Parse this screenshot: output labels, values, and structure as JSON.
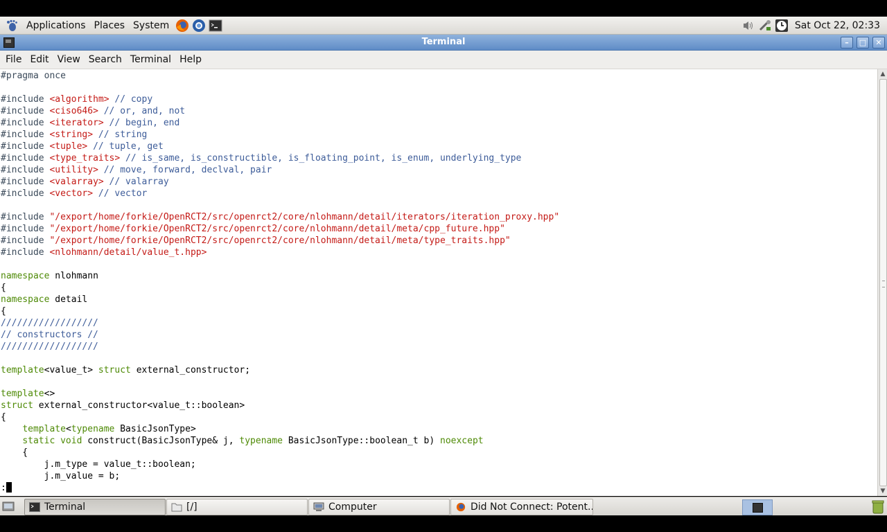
{
  "panel": {
    "menus": [
      "Applications",
      "Places",
      "System"
    ],
    "clock": "Sat Oct 22, 02:33"
  },
  "window": {
    "title": "Terminal",
    "menu": [
      "File",
      "Edit",
      "View",
      "Search",
      "Terminal",
      "Help"
    ]
  },
  "terminal": {
    "lines": [
      [
        [
          "pp",
          "#pragma once"
        ]
      ],
      [],
      [
        [
          "inc",
          "#include "
        ],
        [
          "hdr",
          "<algorithm>"
        ],
        [
          "cmt",
          " // copy"
        ]
      ],
      [
        [
          "inc",
          "#include "
        ],
        [
          "hdr",
          "<ciso646>"
        ],
        [
          "cmt",
          " // or, and, not"
        ]
      ],
      [
        [
          "inc",
          "#include "
        ],
        [
          "hdr",
          "<iterator>"
        ],
        [
          "cmt",
          " // begin, end"
        ]
      ],
      [
        [
          "inc",
          "#include "
        ],
        [
          "hdr",
          "<string>"
        ],
        [
          "cmt",
          " // string"
        ]
      ],
      [
        [
          "inc",
          "#include "
        ],
        [
          "hdr",
          "<tuple>"
        ],
        [
          "cmt",
          " // tuple, get"
        ]
      ],
      [
        [
          "inc",
          "#include "
        ],
        [
          "hdr",
          "<type_traits>"
        ],
        [
          "cmt",
          " // is_same, is_constructible, is_floating_point, is_enum, underlying_type"
        ]
      ],
      [
        [
          "inc",
          "#include "
        ],
        [
          "hdr",
          "<utility>"
        ],
        [
          "cmt",
          " // move, forward, declval, pair"
        ]
      ],
      [
        [
          "inc",
          "#include "
        ],
        [
          "hdr",
          "<valarray>"
        ],
        [
          "cmt",
          " // valarray"
        ]
      ],
      [
        [
          "inc",
          "#include "
        ],
        [
          "hdr",
          "<vector>"
        ],
        [
          "cmt",
          " // vector"
        ]
      ],
      [],
      [
        [
          "inc",
          "#include "
        ],
        [
          "hdr",
          "\"/export/home/forkie/OpenRCT2/src/openrct2/core/nlohmann/detail/iterators/iteration_proxy.hpp\""
        ]
      ],
      [
        [
          "inc",
          "#include "
        ],
        [
          "hdr",
          "\"/export/home/forkie/OpenRCT2/src/openrct2/core/nlohmann/detail/meta/cpp_future.hpp\""
        ]
      ],
      [
        [
          "inc",
          "#include "
        ],
        [
          "hdr",
          "\"/export/home/forkie/OpenRCT2/src/openrct2/core/nlohmann/detail/meta/type_traits.hpp\""
        ]
      ],
      [
        [
          "inc",
          "#include "
        ],
        [
          "hdr",
          "<nlohmann/detail/value_t.hpp>"
        ]
      ],
      [],
      [
        [
          "kw",
          "namespace"
        ],
        [
          "tx",
          " nlohmann"
        ]
      ],
      [
        [
          "tx",
          "{"
        ]
      ],
      [
        [
          "kw",
          "namespace"
        ],
        [
          "tx",
          " detail"
        ]
      ],
      [
        [
          "tx",
          "{"
        ]
      ],
      [
        [
          "cmt",
          "//////////////////"
        ]
      ],
      [
        [
          "cmt",
          "// constructors //"
        ]
      ],
      [
        [
          "cmt",
          "//////////////////"
        ]
      ],
      [],
      [
        [
          "kw",
          "template"
        ],
        [
          "tx",
          "<value_t> "
        ],
        [
          "kw",
          "struct"
        ],
        [
          "tx",
          " external_constructor;"
        ]
      ],
      [],
      [
        [
          "kw",
          "template"
        ],
        [
          "tx",
          "<>"
        ]
      ],
      [
        [
          "kw",
          "struct"
        ],
        [
          "tx",
          " external_constructor<value_t::boolean>"
        ]
      ],
      [
        [
          "tx",
          "{"
        ]
      ],
      [
        [
          "tx",
          "    "
        ],
        [
          "kw",
          "template"
        ],
        [
          "tx",
          "<"
        ],
        [
          "kw",
          "typename"
        ],
        [
          "tx",
          " BasicJsonType>"
        ]
      ],
      [
        [
          "tx",
          "    "
        ],
        [
          "kw",
          "static void"
        ],
        [
          "tx",
          " construct(BasicJsonType& j, "
        ],
        [
          "kw",
          "typename"
        ],
        [
          "tx",
          " BasicJsonType::boolean_t b) "
        ],
        [
          "kw",
          "noexcept"
        ]
      ],
      [
        [
          "tx",
          "    {"
        ]
      ],
      [
        [
          "tx",
          "        j.m_type = value_t::boolean;"
        ]
      ],
      [
        [
          "tx",
          "        j.m_value = b;"
        ]
      ]
    ],
    "prompt": ":"
  },
  "taskbar": {
    "items": [
      {
        "label": "Terminal",
        "active": true
      },
      {
        "label": "[/]",
        "active": false
      },
      {
        "label": "Computer",
        "active": false
      },
      {
        "label": "Did Not Connect: Potent...",
        "active": false
      }
    ]
  },
  "colors": {
    "keyword": "#4e8a06",
    "header": "#c41a16",
    "comment": "#3d5c99",
    "titlebar": "#6f98cf"
  }
}
